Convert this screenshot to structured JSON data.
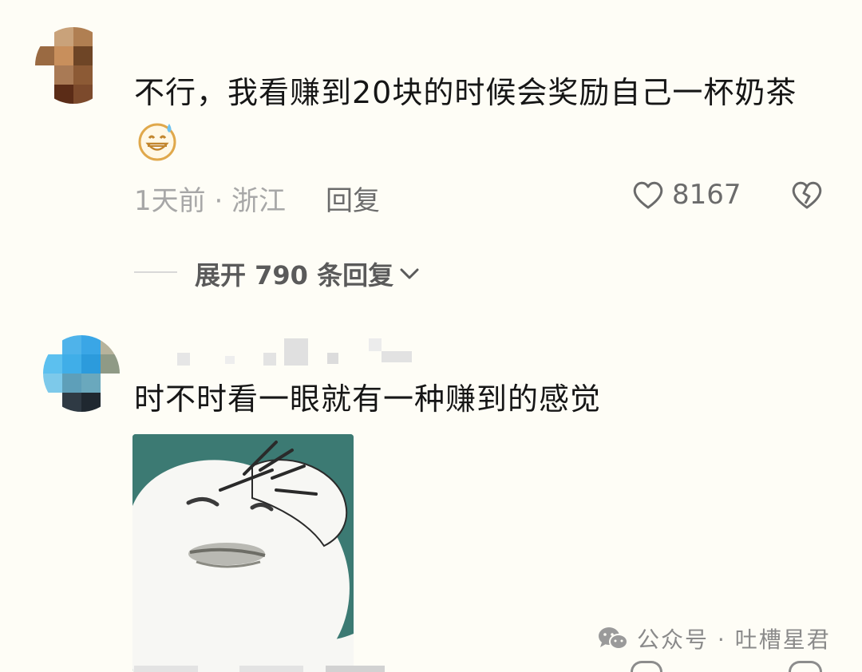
{
  "comments": [
    {
      "text": "不行，我看赚到20块的时候会奖励自己一杯奶茶",
      "emoji": "grin-sweat-emoji",
      "time_location": "1天前 · 浙江",
      "reply_label": "回复",
      "like_count": "8167",
      "expand_label": "展开 790 条回复"
    },
    {
      "text": "时不时看一眼就有一种赚到的感觉",
      "sticker": "facepalm-meme-sticker"
    }
  ],
  "watermark": {
    "icon": "wechat-icon",
    "text": "公众号 · 吐槽星君"
  },
  "colors": {
    "background": "#fefdf6",
    "meta_gray": "#a7a7a7",
    "action_gray": "#6b6b6b",
    "sticker_bg": "#3c7a73"
  }
}
